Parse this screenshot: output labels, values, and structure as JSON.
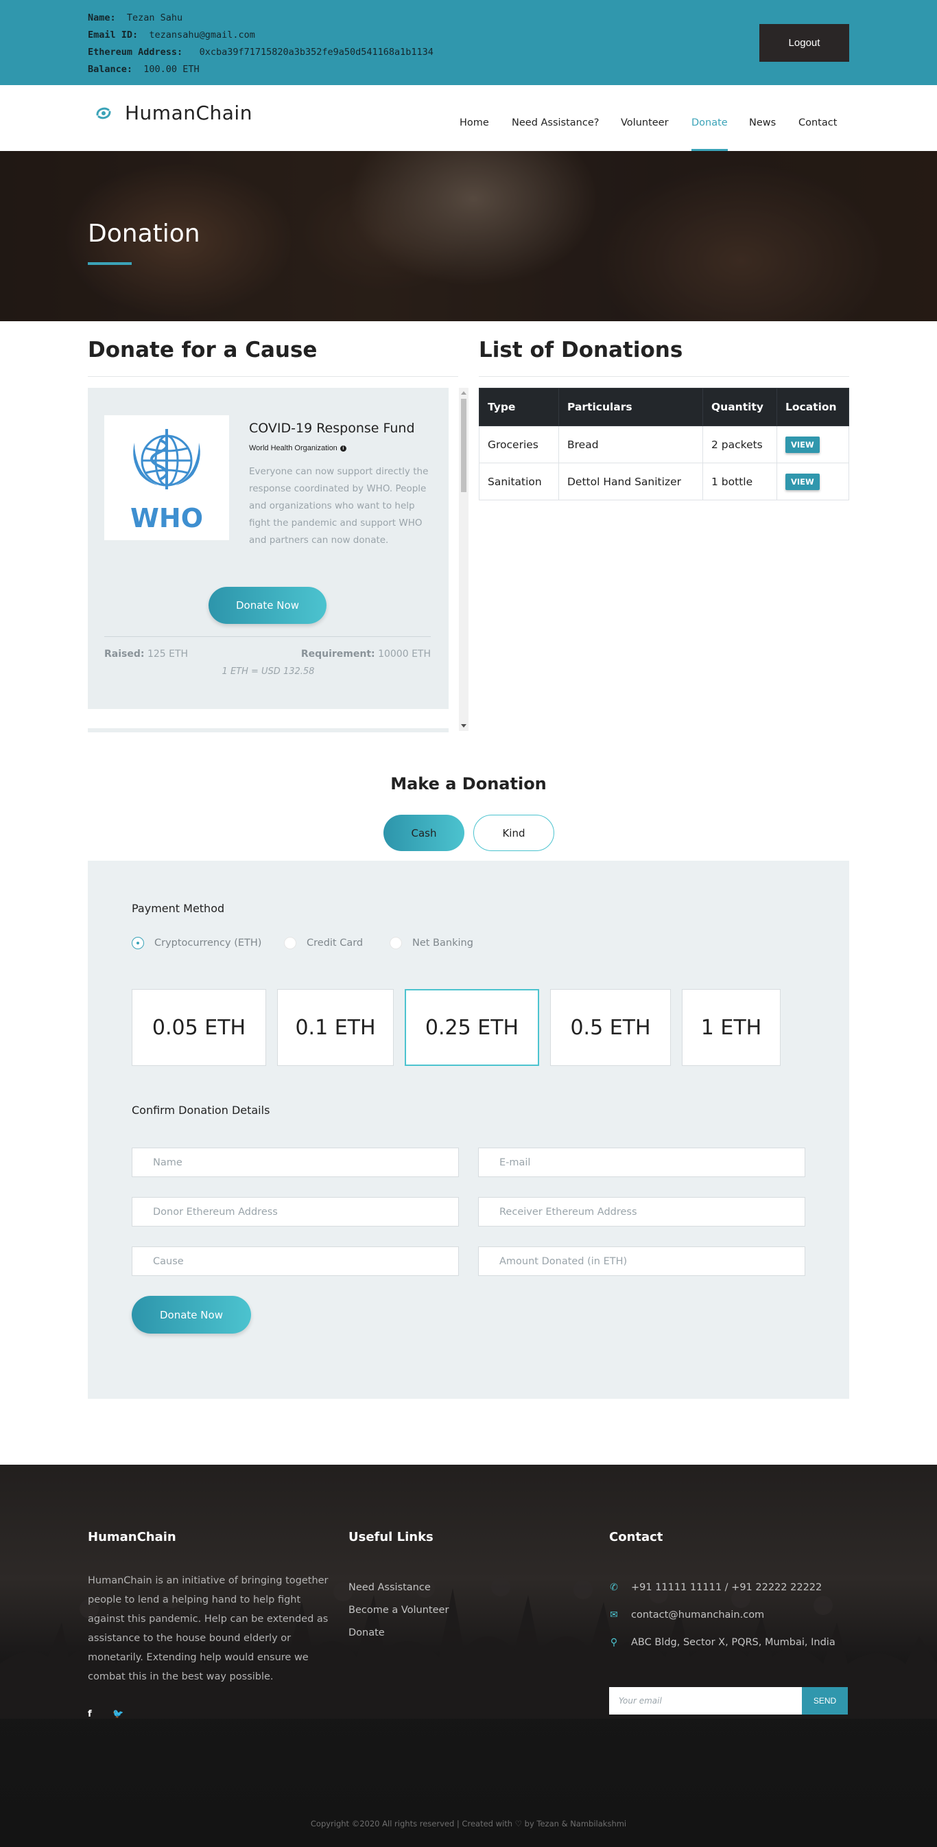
{
  "account": {
    "name_label": "Name:",
    "name": "Tezan Sahu",
    "email_label": "Email ID:",
    "email": "tezansahu@gmail.com",
    "eth_label": "Ethereum Address:",
    "eth_address": "0xcba39f71715820a3b352fe9a50d541168a1b1134",
    "balance_label": "Balance:",
    "balance": "100.00 ETH",
    "logout_label": "Logout"
  },
  "nav": {
    "brand": "HumanChain",
    "brand_icon": "humanchain-logo-icon",
    "items": [
      {
        "label": "Home",
        "active": false
      },
      {
        "label": "Need Assistance?",
        "active": false
      },
      {
        "label": "Volunteer",
        "active": false
      },
      {
        "label": "Donate",
        "active": true
      },
      {
        "label": "News",
        "active": false
      },
      {
        "label": "Contact",
        "active": false
      }
    ]
  },
  "hero": {
    "title": "Donation"
  },
  "cause": {
    "section_title": "Donate for a Cause",
    "logo_text": "WHO",
    "fund_title": "COVID-19 Response Fund",
    "organization": "World Health Organization",
    "description": "Everyone can now support directly the response coordinated by WHO. People and organizations who want to help fight the pandemic and support WHO and partners can now donate.",
    "donate_label": "Donate Now",
    "raised_label": "Raised:",
    "raised_value": "125 ETH",
    "requirement_label": "Requirement:",
    "requirement_value": "10000 ETH",
    "rate": "1 ETH = USD 132.58"
  },
  "donations_list": {
    "section_title": "List of Donations",
    "columns": [
      "Type",
      "Particulars",
      "Quantity",
      "Location"
    ],
    "rows": [
      {
        "type": "Groceries",
        "particulars": "Bread",
        "quantity": "2 packets",
        "location": "VIEW"
      },
      {
        "type": "Sanitation",
        "particulars": "Dettol Hand Sanitizer",
        "quantity": "1 bottle",
        "location": "VIEW"
      }
    ]
  },
  "make_donation": {
    "title": "Make a Donation",
    "tabs": [
      {
        "label": "Cash",
        "active": true
      },
      {
        "label": "Kind",
        "active": false
      }
    ],
    "payment_method_label": "Payment Method",
    "payment_methods": [
      {
        "label": "Cryptocurrency (ETH)",
        "selected": true
      },
      {
        "label": "Credit Card",
        "selected": false
      },
      {
        "label": "Net Banking",
        "selected": false
      }
    ],
    "amounts": [
      {
        "label": "0.05 ETH",
        "selected": false
      },
      {
        "label": "0.1 ETH",
        "selected": false
      },
      {
        "label": "0.25 ETH",
        "selected": true
      },
      {
        "label": "0.5 ETH",
        "selected": false
      },
      {
        "label": "1 ETH",
        "selected": false
      }
    ],
    "confirm_label": "Confirm Donation Details",
    "fields": {
      "name": {
        "placeholder": "Name",
        "value": ""
      },
      "email": {
        "placeholder": "E-mail",
        "value": ""
      },
      "donor_address": {
        "placeholder": "Donor Ethereum Address",
        "value": ""
      },
      "receiver_address": {
        "placeholder": "Receiver Ethereum Address",
        "value": ""
      },
      "cause": {
        "placeholder": "Cause",
        "value": ""
      },
      "amount": {
        "placeholder": "Amount Donated (in ETH)",
        "value": ""
      }
    },
    "submit_label": "Donate Now"
  },
  "footer": {
    "about_title": "HumanChain",
    "about_text": "HumanChain is an initiative of bringing together people to lend a helping hand to help fight against this pandemic. Help can be extended as assistance to the house bound elderly or monetarily. Extending help would ensure we combat this in the best way possible.",
    "social": [
      {
        "label": "f",
        "icon": "facebook-icon"
      },
      {
        "label": "🐦",
        "icon": "twitter-icon"
      }
    ],
    "links_title": "Useful Links",
    "links": [
      "Need Assistance",
      "Become a Volunteer",
      "Donate"
    ],
    "contact_title": "Contact",
    "phone": "+91 11111 11111 / +91 22222 22222",
    "email": "contact@humanchain.com",
    "address": "ABC Bldg, Sector X, PQRS, Mumbai, India",
    "newsletter_placeholder": "Your email",
    "send_label": "SEND",
    "copyright_prefix": "Copyright ©2020 All rights reserved | Created with",
    "copyright_suffix": "by Tezan & Nambilakshmi"
  },
  "colors": {
    "accent": "#3097ad",
    "accent_light": "#4cc3cf",
    "dark": "#23272b",
    "panel_bg": "#ebf0f2"
  }
}
